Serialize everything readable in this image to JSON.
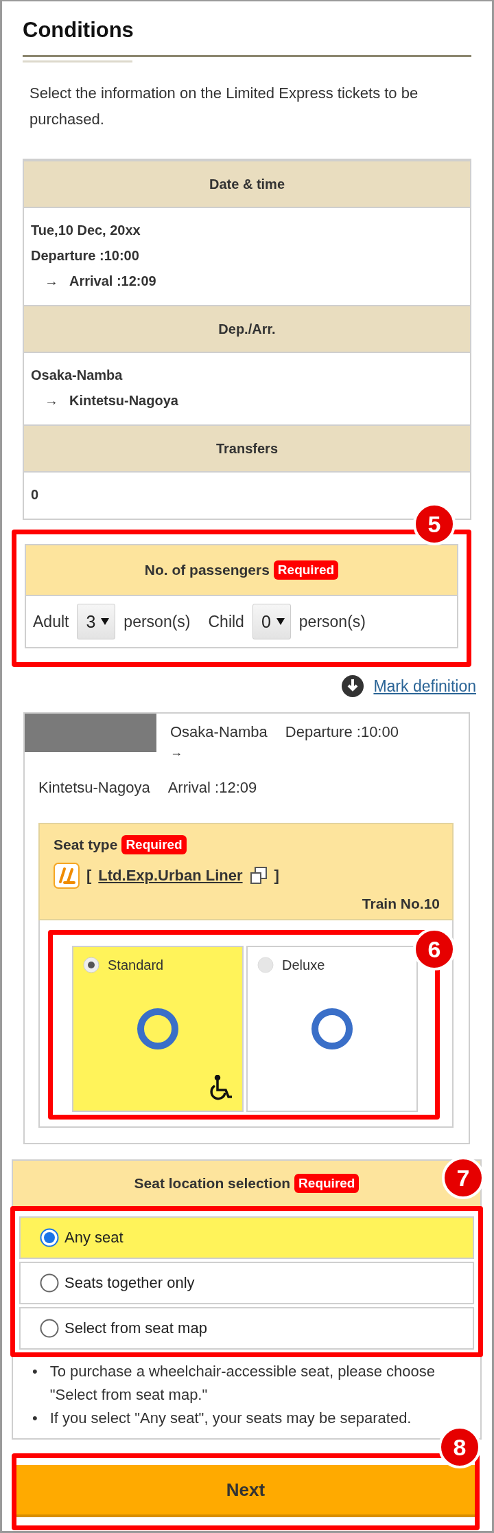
{
  "title": "Conditions",
  "intro": "Select the information on the Limited Express tickets to be purchased.",
  "summary": [
    {
      "heading": "Date & time",
      "lines": [
        {
          "text": "Tue,10 Dec, 20xx"
        },
        {
          "text": "Departure :10:00"
        },
        {
          "arrow": "→",
          "text": "Arrival :12:09"
        }
      ]
    },
    {
      "heading": "Dep./Arr.",
      "lines": [
        {
          "text": "Osaka-Namba"
        },
        {
          "arrow": "→",
          "text": "Kintetsu-Nagoya"
        }
      ]
    },
    {
      "heading": "Transfers",
      "lines": [
        {
          "text": "0"
        }
      ]
    }
  ],
  "passengers": {
    "heading": "No. of passengers",
    "badge": "Required",
    "callout": "5",
    "fields": [
      {
        "label": "Adult",
        "value": "3",
        "unit": "person(s)"
      },
      {
        "label": "Child",
        "value": "0",
        "unit": "person(s)"
      }
    ]
  },
  "mark_definition": "Mark definition",
  "train": {
    "origin": "Osaka-Namba",
    "departure": "Departure :10:00",
    "arrow": "→",
    "destination": "Kintetsu-Nagoya",
    "arrival": "Arrival :12:09",
    "seat_type": {
      "heading": "Seat type",
      "badge": "Required",
      "open_bracket": "[",
      "link": "Ltd.Exp.Urban Liner",
      "close_bracket": "]",
      "train_no": "Train No.10",
      "callout": "6",
      "options": [
        {
          "label": "Standard",
          "selected": true,
          "wheelchair": true
        },
        {
          "label": "Deluxe",
          "selected": false,
          "wheelchair": false
        }
      ]
    }
  },
  "seat_location": {
    "heading": "Seat location selection",
    "badge": "Required",
    "callout": "7",
    "options": [
      {
        "label": "Any seat",
        "selected": true
      },
      {
        "label": "Seats together only",
        "selected": false
      },
      {
        "label": "Select from seat map",
        "selected": false
      }
    ],
    "notes": [
      {
        "bullet": "•",
        "text": "To purchase a wheelchair-accessible seat, please choose \"Select from seat map.\""
      },
      {
        "bullet": "•",
        "text": "If you select \"Any seat\", your seats may be separated."
      }
    ]
  },
  "next": {
    "label": "Next",
    "callout": "8"
  }
}
